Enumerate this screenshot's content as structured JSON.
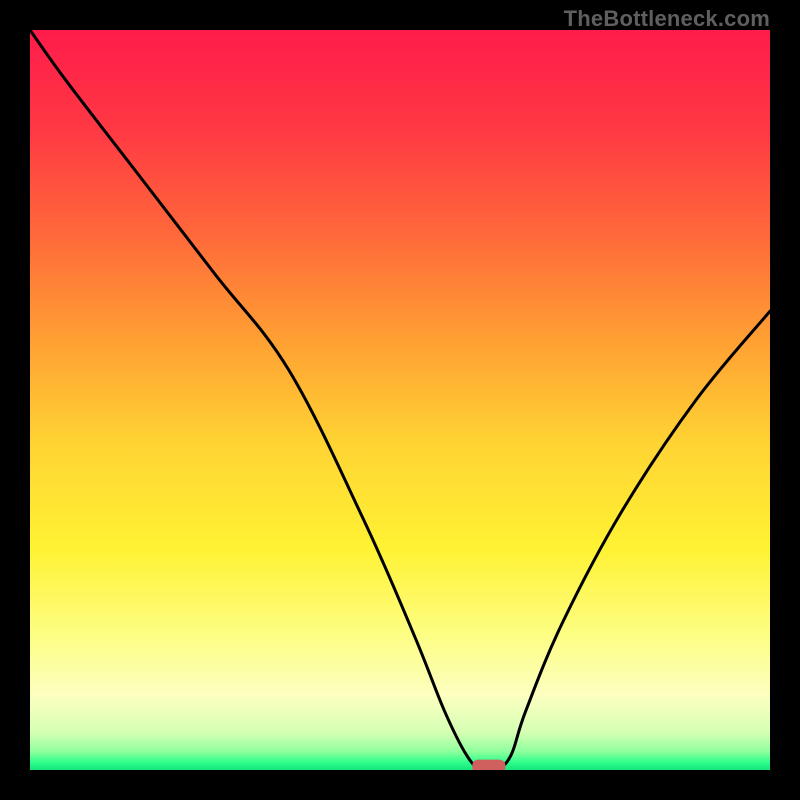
{
  "watermark": "TheBottleneck.com",
  "chart_data": {
    "type": "line",
    "title": "",
    "xlabel": "",
    "ylabel": "",
    "xlim": [
      0,
      100
    ],
    "ylim": [
      0,
      100
    ],
    "grid": false,
    "background_gradient_stops": [
      {
        "pct": 0,
        "color": "#ff1b4b"
      },
      {
        "pct": 14,
        "color": "#ff3a43"
      },
      {
        "pct": 28,
        "color": "#ff6a3a"
      },
      {
        "pct": 42,
        "color": "#ffa033"
      },
      {
        "pct": 56,
        "color": "#ffd433"
      },
      {
        "pct": 70,
        "color": "#fff233"
      },
      {
        "pct": 82,
        "color": "#fdfe85"
      },
      {
        "pct": 90,
        "color": "#fcffc0"
      },
      {
        "pct": 95,
        "color": "#d4ffb3"
      },
      {
        "pct": 97.5,
        "color": "#8fff9d"
      },
      {
        "pct": 99,
        "color": "#2cff8b"
      },
      {
        "pct": 100,
        "color": "#17e37f"
      }
    ],
    "series": [
      {
        "name": "bottleneck-curve",
        "x": [
          0,
          5,
          15,
          25,
          35,
          45,
          52,
          56,
          59,
          61,
          63,
          65,
          67,
          72,
          80,
          90,
          100
        ],
        "y": [
          100,
          93,
          80,
          67,
          54,
          34,
          18,
          8,
          2,
          0,
          0,
          2,
          8,
          20,
          35,
          50,
          62
        ]
      }
    ],
    "marker": {
      "name": "optimal-point",
      "x": 62,
      "y": 0.5,
      "color": "#d0605e",
      "width_pct": 4.5,
      "height_pct": 1.8
    }
  }
}
